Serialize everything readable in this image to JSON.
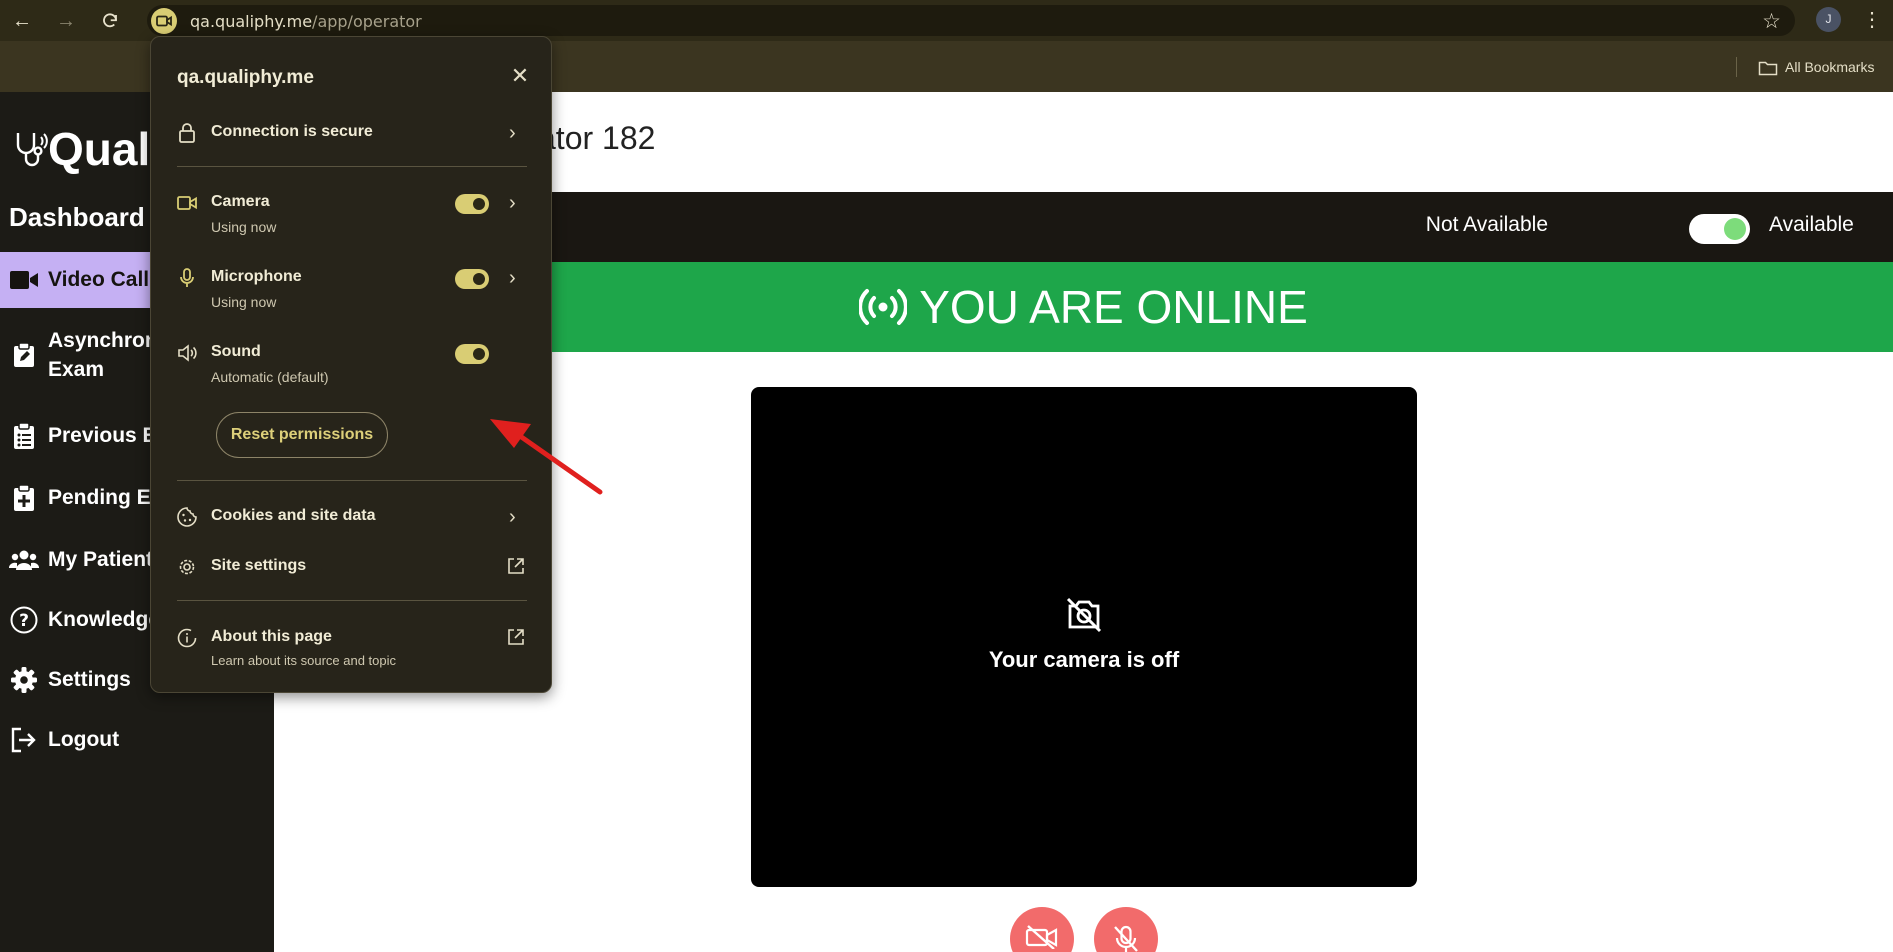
{
  "browser": {
    "url_host": "qa.qualiphy.me",
    "url_path": "/app/operator",
    "profile_initial": "J",
    "bookmarks_label": "All Bookmarks"
  },
  "sidebar": {
    "logo_text": "Qual",
    "title": "Dashboard",
    "items": [
      {
        "label": "Video Call",
        "icon": "video-icon"
      },
      {
        "label": "Asynchron",
        "label_line2": "Exam",
        "icon": "clipboard-pen-icon"
      },
      {
        "label": "Previous E",
        "icon": "clipboard-list-icon"
      },
      {
        "label": "Pending Ex",
        "icon": "clipboard-plus-icon"
      },
      {
        "label": "My Patient",
        "icon": "users-icon"
      },
      {
        "label": "Knowledge",
        "icon": "question-circle-icon"
      },
      {
        "label": "Settings",
        "icon": "gear-icon"
      },
      {
        "label": "Logout",
        "icon": "logout-icon"
      }
    ]
  },
  "main": {
    "header_name": "ator 182",
    "availability": {
      "off_label": "Not Available",
      "on_label": "Available",
      "is_available": true
    },
    "online_banner": "YOU ARE ONLINE",
    "camera_off_text": "Your camera is off"
  },
  "site_info_popup": {
    "host": "qa.qualiphy.me",
    "connection_label": "Connection is secure",
    "permissions": [
      {
        "label": "Camera",
        "status": "Using now",
        "enabled": true
      },
      {
        "label": "Microphone",
        "status": "Using now",
        "enabled": true
      },
      {
        "label": "Sound",
        "status": "Automatic (default)",
        "enabled": true
      }
    ],
    "reset_label": "Reset permissions",
    "cookies_label": "Cookies and site data",
    "site_settings_label": "Site settings",
    "about_label": "About this page",
    "about_sub": "Learn about its source and topic"
  },
  "colors": {
    "accent_yellow": "#d9cd74",
    "online_green": "#1ea64a",
    "active_purple": "#c5b0f3",
    "control_red": "#f26b6b",
    "arrow_red": "#e0201e"
  }
}
